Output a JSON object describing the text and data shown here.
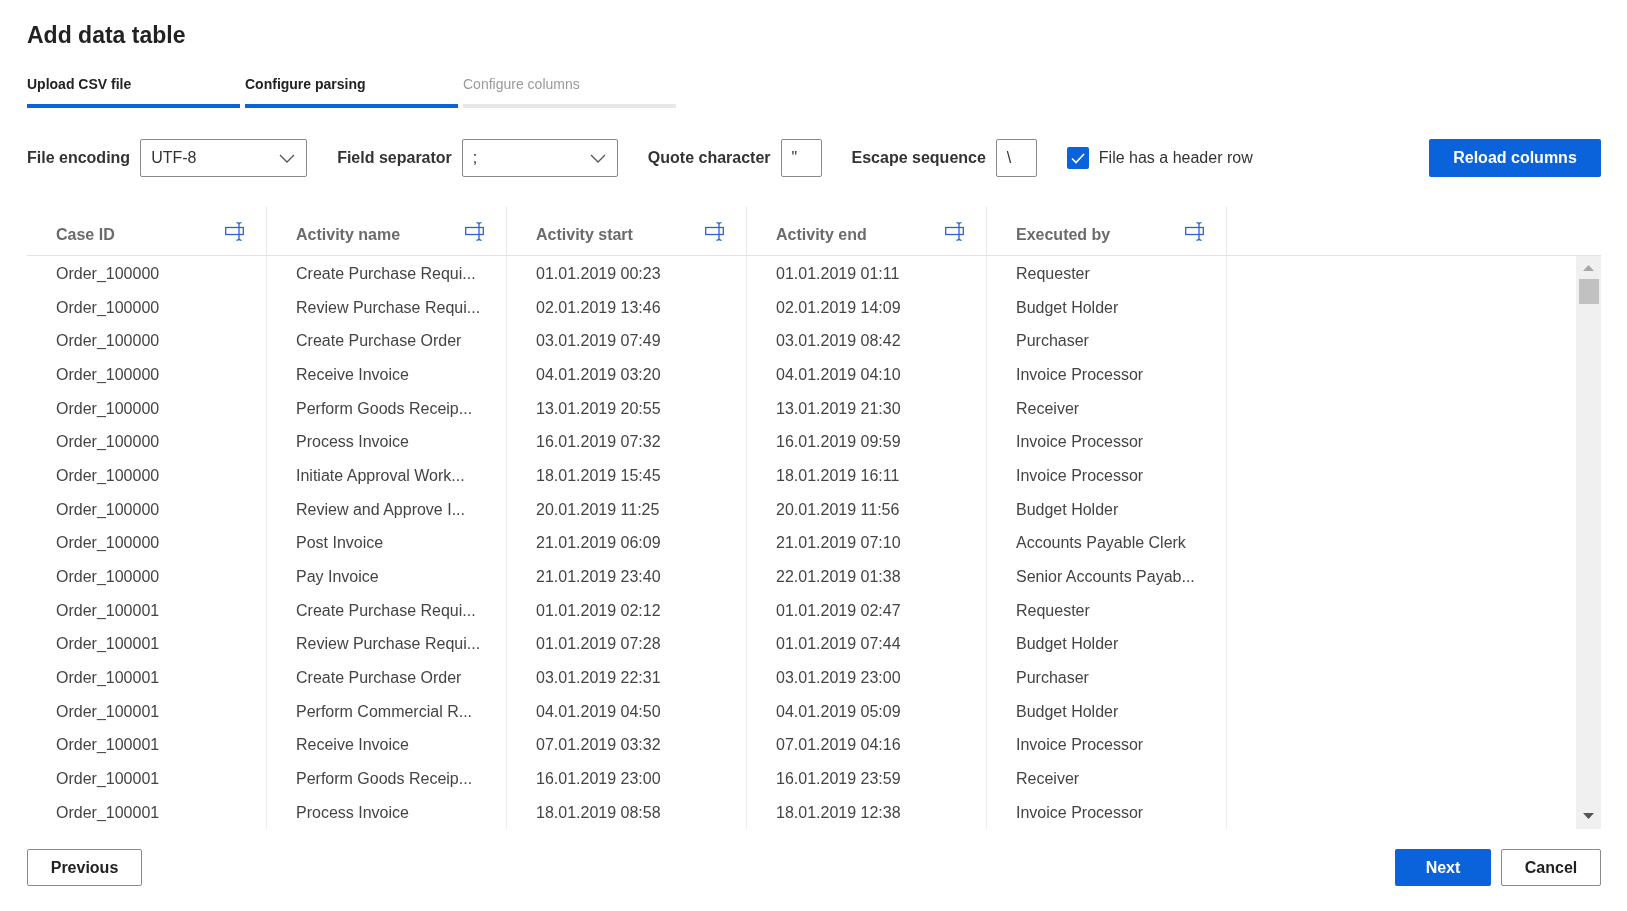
{
  "dialog": {
    "title": "Add data table"
  },
  "steps": [
    {
      "label": "Upload CSV file",
      "active": true
    },
    {
      "label": "Configure parsing",
      "active": true
    },
    {
      "label": "Configure columns",
      "active": false
    }
  ],
  "parsing": {
    "fields": [
      {
        "kind": "select",
        "label": "File encoding",
        "value": "UTF-8"
      },
      {
        "kind": "select",
        "label": "Field separator",
        "value": ";"
      },
      {
        "kind": "text",
        "label": "Quote character",
        "value": "\""
      },
      {
        "kind": "text",
        "label": "Escape sequence",
        "value": "\\"
      }
    ],
    "header_row": {
      "label": "File has a header row",
      "checked": true
    },
    "reload_button": "Reload columns"
  },
  "table": {
    "columns": [
      "Case ID",
      "Activity name",
      "Activity start",
      "Activity end",
      "Executed by"
    ],
    "rows": [
      [
        "Order_100000",
        "Create Purchase Requi...",
        "01.01.2019 00:23",
        "01.01.2019 01:11",
        "Requester"
      ],
      [
        "Order_100000",
        "Review Purchase Requi...",
        "02.01.2019 13:46",
        "02.01.2019 14:09",
        "Budget Holder"
      ],
      [
        "Order_100000",
        "Create Purchase Order",
        "03.01.2019 07:49",
        "03.01.2019 08:42",
        "Purchaser"
      ],
      [
        "Order_100000",
        "Receive Invoice",
        "04.01.2019 03:20",
        "04.01.2019 04:10",
        "Invoice Processor"
      ],
      [
        "Order_100000",
        "Perform Goods Receip...",
        "13.01.2019 20:55",
        "13.01.2019 21:30",
        "Receiver"
      ],
      [
        "Order_100000",
        "Process Invoice",
        "16.01.2019 07:32",
        "16.01.2019 09:59",
        "Invoice Processor"
      ],
      [
        "Order_100000",
        "Initiate Approval Work...",
        "18.01.2019 15:45",
        "18.01.2019 16:11",
        "Invoice Processor"
      ],
      [
        "Order_100000",
        "Review and Approve I...",
        "20.01.2019 11:25",
        "20.01.2019 11:56",
        "Budget Holder"
      ],
      [
        "Order_100000",
        "Post Invoice",
        "21.01.2019 06:09",
        "21.01.2019 07:10",
        "Accounts Payable Clerk"
      ],
      [
        "Order_100000",
        "Pay Invoice",
        "21.01.2019 23:40",
        "22.01.2019 01:38",
        "Senior Accounts Payab..."
      ],
      [
        "Order_100001",
        "Create Purchase Requi...",
        "01.01.2019 02:12",
        "01.01.2019 02:47",
        "Requester"
      ],
      [
        "Order_100001",
        "Review Purchase Requi...",
        "01.01.2019 07:28",
        "01.01.2019 07:44",
        "Budget Holder"
      ],
      [
        "Order_100001",
        "Create Purchase Order",
        "03.01.2019 22:31",
        "03.01.2019 23:00",
        "Purchaser"
      ],
      [
        "Order_100001",
        "Perform Commercial R...",
        "04.01.2019 04:50",
        "04.01.2019 05:09",
        "Budget Holder"
      ],
      [
        "Order_100001",
        "Receive Invoice",
        "07.01.2019 03:32",
        "07.01.2019 04:16",
        "Invoice Processor"
      ],
      [
        "Order_100001",
        "Perform Goods Receip...",
        "16.01.2019 23:00",
        "16.01.2019 23:59",
        "Receiver"
      ],
      [
        "Order_100001",
        "Process Invoice",
        "18.01.2019 08:58",
        "18.01.2019 12:38",
        "Invoice Processor"
      ]
    ]
  },
  "footer": {
    "previous": "Previous",
    "next": "Next",
    "cancel": "Cancel"
  }
}
